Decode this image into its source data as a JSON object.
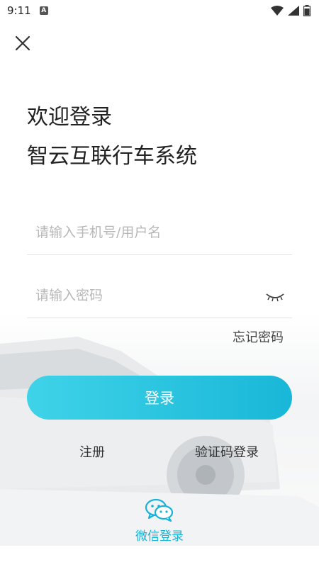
{
  "status": {
    "time": "9:11",
    "badge": "A"
  },
  "header": {
    "close_icon": "close-icon"
  },
  "titles": {
    "welcome": "欢迎登录",
    "system": "智云互联行车系统"
  },
  "form": {
    "username_placeholder": "请输入手机号/用户名",
    "password_placeholder": "请输入密码",
    "forgot_label": "忘记密码"
  },
  "actions": {
    "login_label": "登录",
    "register_label": "注册",
    "code_login_label": "验证码登录"
  },
  "wechat": {
    "label": "微信登录",
    "icon": "wechat-icon"
  },
  "colors": {
    "accent": "#19b7d8",
    "gradient_start": "#3fd3e8"
  }
}
